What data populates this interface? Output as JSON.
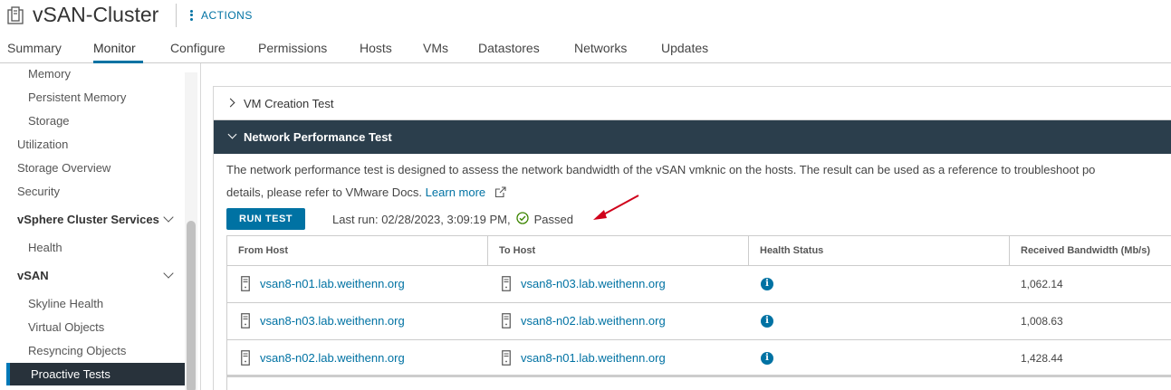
{
  "header": {
    "title": "vSAN-Cluster",
    "actions_label": "ACTIONS"
  },
  "tabs": [
    {
      "label": "Summary"
    },
    {
      "label": "Monitor",
      "active": true
    },
    {
      "label": "Configure"
    },
    {
      "label": "Permissions"
    },
    {
      "label": "Hosts"
    },
    {
      "label": "VMs"
    },
    {
      "label": "Datastores"
    },
    {
      "label": "Networks"
    },
    {
      "label": "Updates"
    }
  ],
  "sidebar": {
    "items": [
      {
        "label": "Memory"
      },
      {
        "label": "Persistent Memory"
      },
      {
        "label": "Storage"
      },
      {
        "label": "Utilization"
      },
      {
        "label": "Storage Overview"
      },
      {
        "label": "Security"
      },
      {
        "label": "vSphere Cluster Services"
      },
      {
        "label": "Health"
      },
      {
        "label": "vSAN"
      },
      {
        "label": "Skyline Health"
      },
      {
        "label": "Virtual Objects"
      },
      {
        "label": "Resyncing Objects"
      },
      {
        "label": "Proactive Tests",
        "active": true
      }
    ]
  },
  "tests": {
    "vm_creation": "VM Creation Test",
    "network_perf": "Network Performance Test"
  },
  "network": {
    "desc_line1": "The network performance test is designed to assess the network bandwidth of the vSAN vmknic on the hosts. The result can be used as a reference to troubleshoot po",
    "desc_line2": "details, please refer to VMware Docs.",
    "learn_more": "Learn more",
    "run_button": "RUN TEST",
    "last_run": "Last run: 02/28/2023, 3:09:19 PM,",
    "status": "Passed"
  },
  "table": {
    "columns": [
      "From Host",
      "To Host",
      "Health Status",
      "Received Bandwidth (Mb/s)"
    ],
    "rows": [
      {
        "from": "vsan8-n01.lab.weithenn.org",
        "to": "vsan8-n03.lab.weithenn.org",
        "bandwidth": "1,062.14"
      },
      {
        "from": "vsan8-n03.lab.weithenn.org",
        "to": "vsan8-n02.lab.weithenn.org",
        "bandwidth": "1,008.63"
      },
      {
        "from": "vsan8-n02.lab.weithenn.org",
        "to": "vsan8-n01.lab.weithenn.org",
        "bandwidth": "1,428.44"
      }
    ]
  },
  "colors": {
    "accent": "#0072a3",
    "expanded_header": "#2b3e4c",
    "nav_active": "#28323b",
    "success": "#3c8500",
    "annotation_arrow": "#d0021b"
  },
  "icons": {
    "cluster": "cluster-icon",
    "server": "server-icon",
    "info": "info-icon",
    "check": "check-circle-icon",
    "external": "external-link-icon"
  }
}
